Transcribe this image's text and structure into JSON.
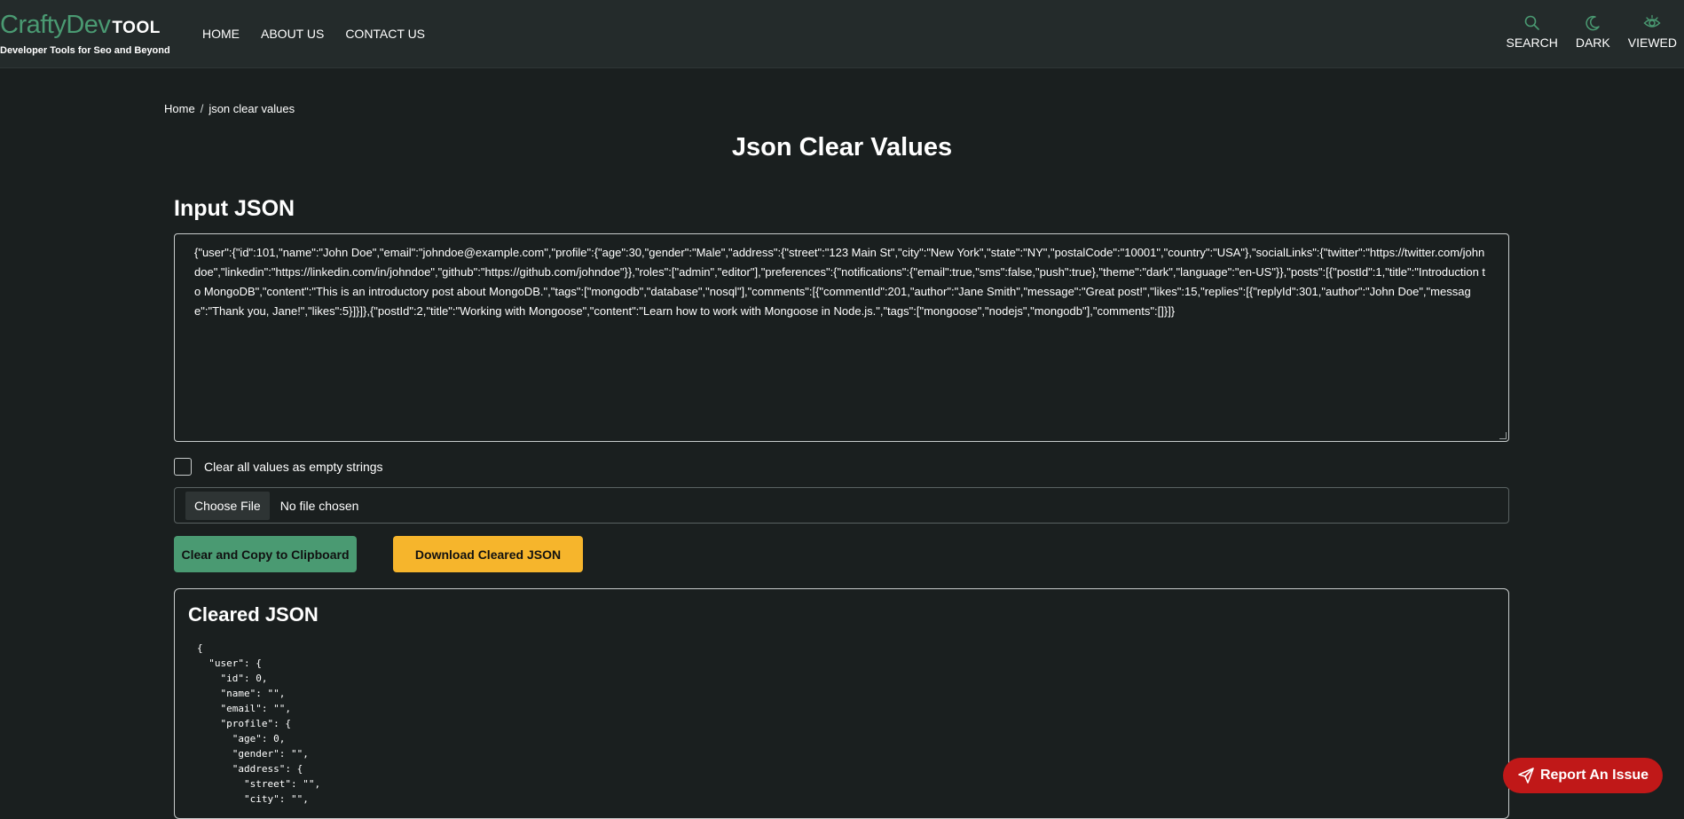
{
  "header": {
    "logo_main": "CraftyDev",
    "logo_tool": "TOOL",
    "logo_subtitle": "Developer Tools for Seo and Beyond",
    "nav": [
      "HOME",
      "ABOUT US",
      "CONTACT US"
    ],
    "tools": [
      {
        "label": "SEARCH",
        "icon": "search-icon"
      },
      {
        "label": "DARK",
        "icon": "moon-icon"
      },
      {
        "label": "VIEWED",
        "icon": "eye-icon"
      }
    ]
  },
  "breadcrumb": {
    "home": "Home",
    "separator": "/",
    "current": "json clear values"
  },
  "page_title": "Json Clear Values",
  "input": {
    "title": "Input JSON",
    "value": "{\"user\":{\"id\":101,\"name\":\"John Doe\",\"email\":\"johndoe@example.com\",\"profile\":{\"age\":30,\"gender\":\"Male\",\"address\":{\"street\":\"123 Main St\",\"city\":\"New York\",\"state\":\"NY\",\"postalCode\":\"10001\",\"country\":\"USA\"},\"socialLinks\":{\"twitter\":\"https://twitter.com/johndoe\",\"linkedin\":\"https://linkedin.com/in/johndoe\",\"github\":\"https://github.com/johndoe\"}},\"roles\":[\"admin\",\"editor\"],\"preferences\":{\"notifications\":{\"email\":true,\"sms\":false,\"push\":true},\"theme\":\"dark\",\"language\":\"en-US\"}},\"posts\":[{\"postId\":1,\"title\":\"Introduction to MongoDB\",\"content\":\"This is an introductory post about MongoDB.\",\"tags\":[\"mongodb\",\"database\",\"nosql\"],\"comments\":[{\"commentId\":201,\"author\":\"Jane Smith\",\"message\":\"Great post!\",\"likes\":15,\"replies\":[{\"replyId\":301,\"author\":\"John Doe\",\"message\":\"Thank you, Jane!\",\"likes\":5}]}]},{\"postId\":2,\"title\":\"Working with Mongoose\",\"content\":\"Learn how to work with Mongoose in Node.js.\",\"tags\":[\"mongoose\",\"nodejs\",\"mongodb\"],\"comments\":[]}]}"
  },
  "checkbox_label": "Clear all values as empty strings",
  "file": {
    "button_label": "Choose File",
    "status": "No file chosen"
  },
  "buttons": {
    "copy": "Clear and Copy to Clipboard",
    "download": "Download Cleared JSON"
  },
  "output": {
    "title": "Cleared JSON",
    "lines": [
      "{",
      "  \"user\": {",
      "    \"id\": 0,",
      "    \"name\": \"\",",
      "    \"email\": \"\",",
      "    \"profile\": {",
      "      \"age\": 0,",
      "      \"gender\": \"\",",
      "      \"address\": {",
      "        \"street\": \"\",",
      "        \"city\": \"\","
    ]
  },
  "report_label": "Report An Issue",
  "colors": {
    "accent_green": "#4a9a72",
    "accent_yellow": "#f6b52c",
    "report_red": "#c01818",
    "background": "#1a1f1f"
  }
}
